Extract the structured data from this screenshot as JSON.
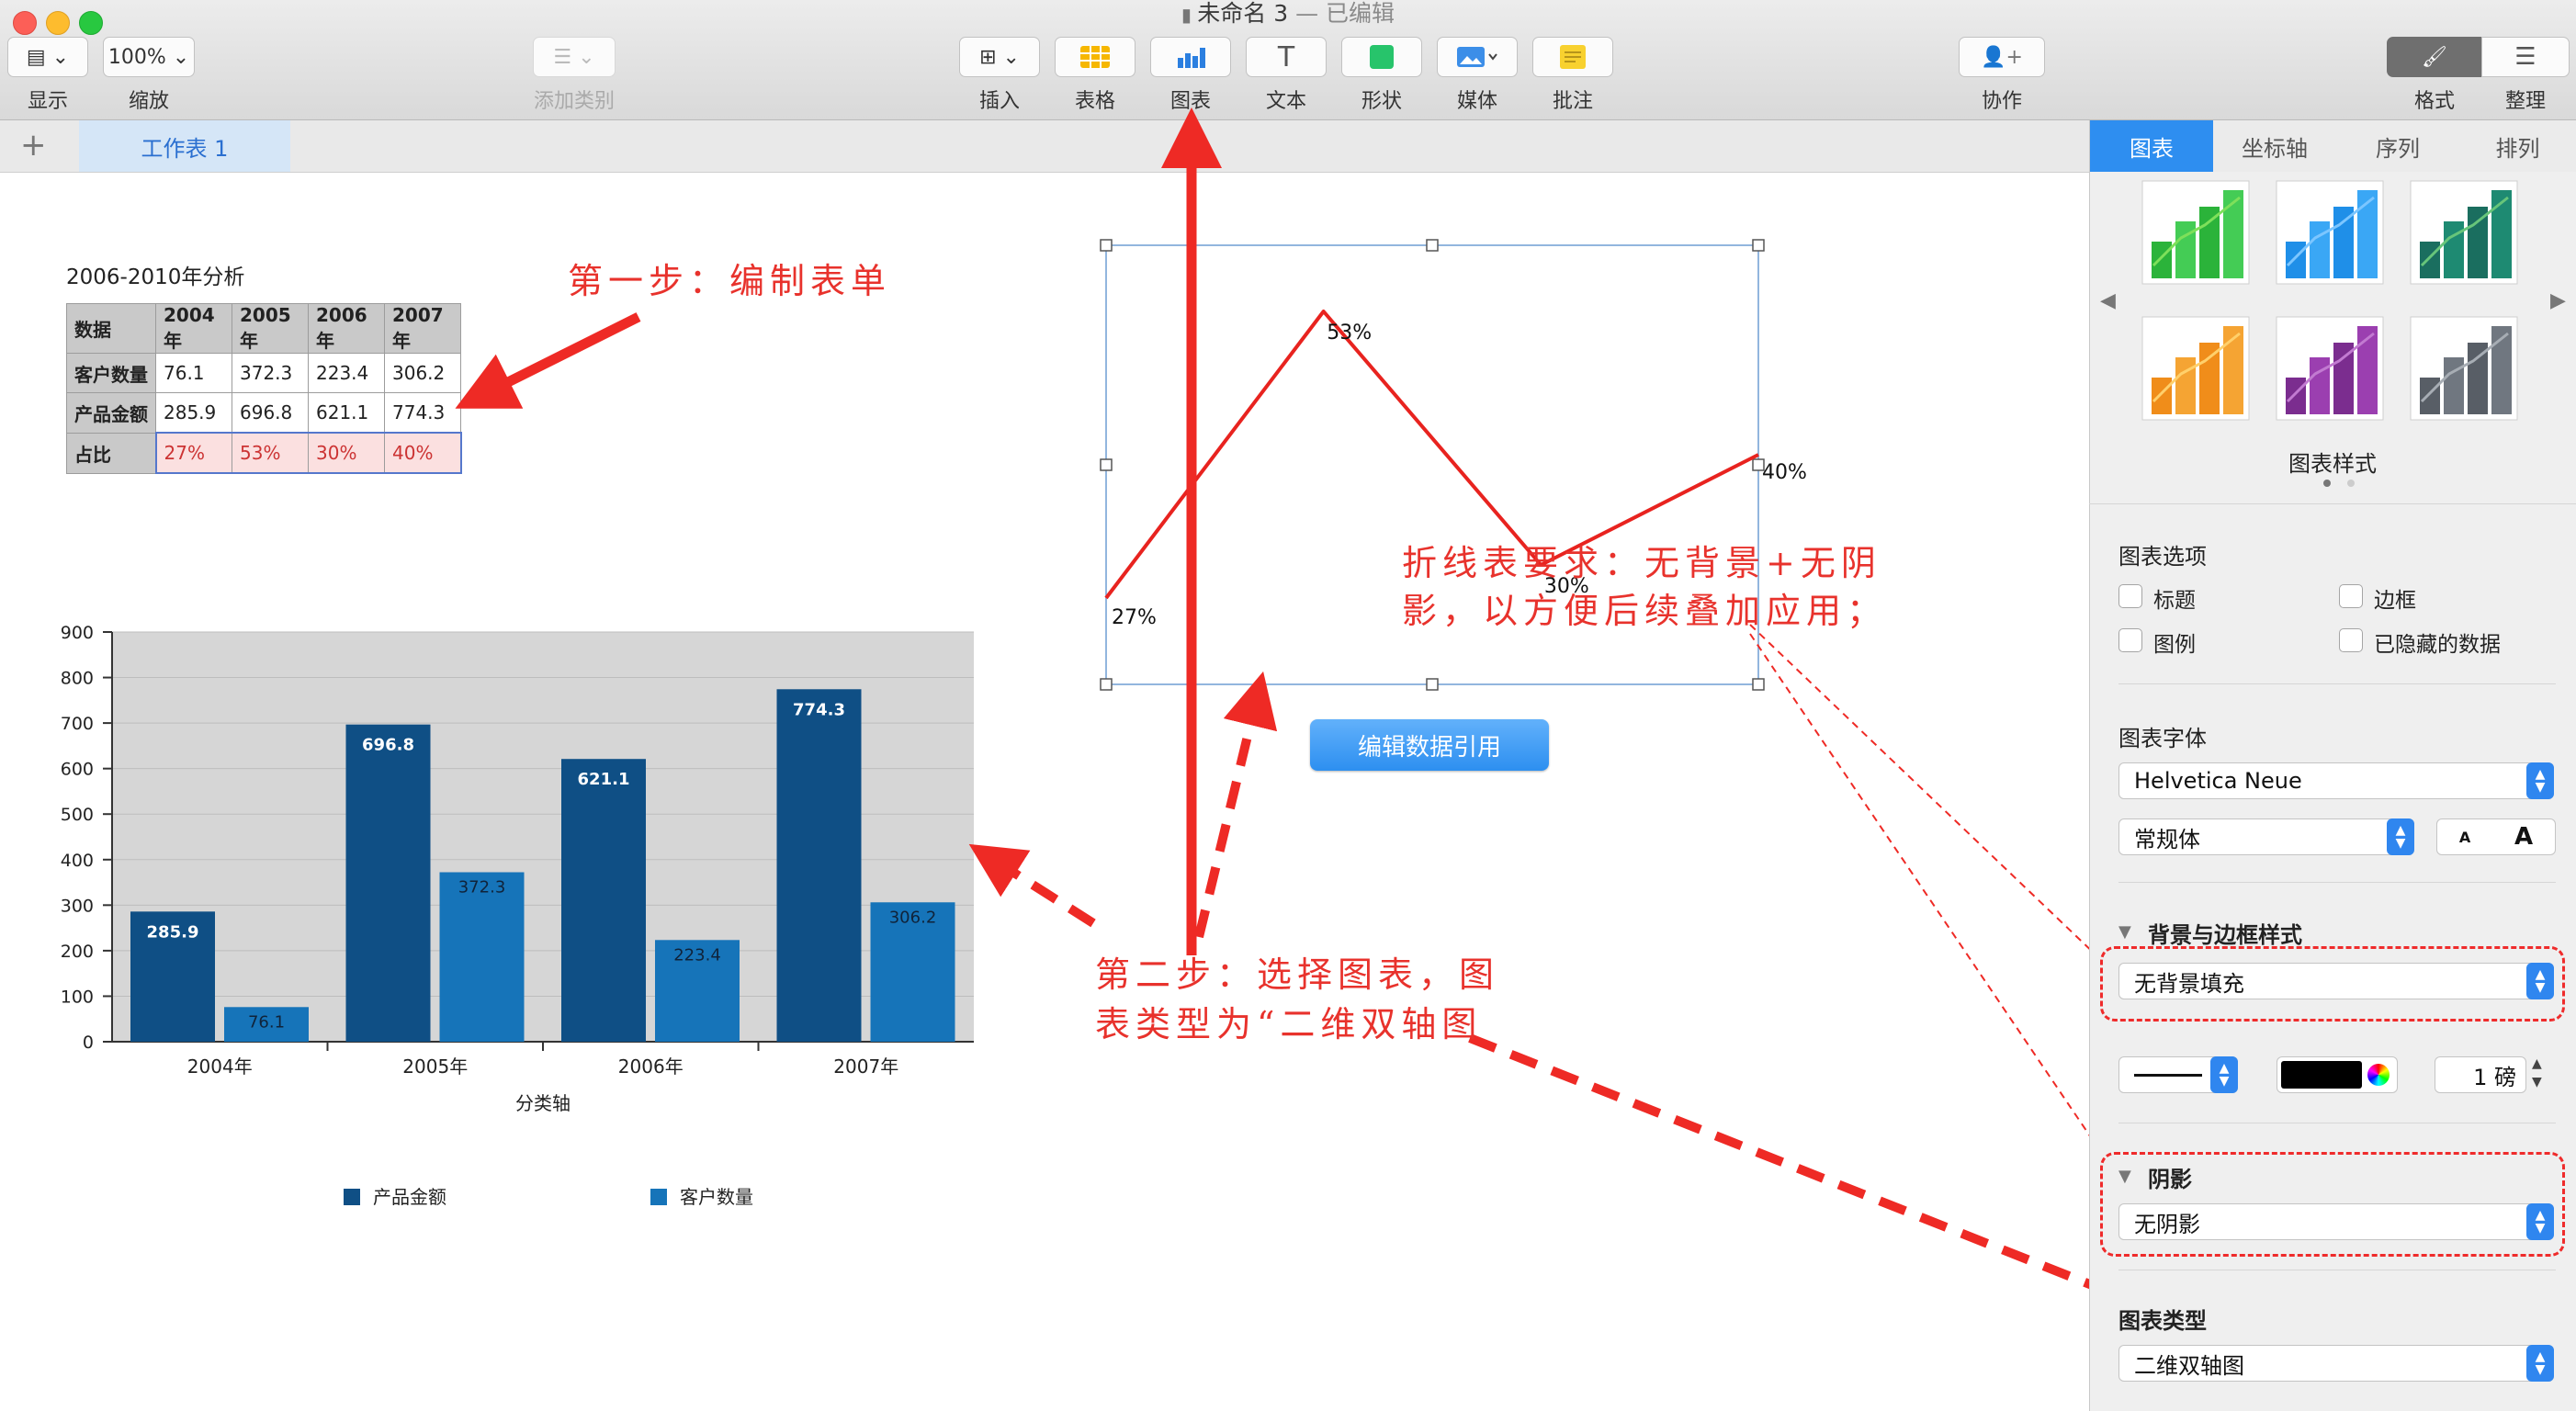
{
  "window": {
    "title": "未命名 3",
    "edited_suffix": " — 已编辑"
  },
  "toolbar": {
    "view": {
      "label": "显示"
    },
    "zoom": {
      "value": "100%",
      "label": "缩放"
    },
    "add_category": {
      "label": "添加类别"
    },
    "insert": {
      "label": "插入"
    },
    "table": {
      "label": "表格"
    },
    "chart": {
      "label": "图表"
    },
    "text": {
      "label": "文本"
    },
    "shape": {
      "label": "形状"
    },
    "media": {
      "label": "媒体"
    },
    "comment": {
      "label": "批注"
    },
    "collaborate": {
      "label": "协作"
    },
    "format": {
      "label": "格式"
    },
    "organize": {
      "label": "整理"
    }
  },
  "sheets": {
    "add": "+",
    "tabs": [
      {
        "label": "工作表 1"
      }
    ]
  },
  "table": {
    "title": "2006-2010年分析",
    "headers": [
      "数据",
      "2004年",
      "2005年",
      "2006年",
      "2007年"
    ],
    "rows": [
      [
        "客户数量",
        "76.1",
        "372.3",
        "223.4",
        "306.2"
      ],
      [
        "产品金额",
        "285.9",
        "696.8",
        "621.1",
        "774.3"
      ],
      [
        "占比",
        "27%",
        "53%",
        "30%",
        "40%"
      ]
    ]
  },
  "bar_chart": {
    "y_ticks": [
      "900",
      "800",
      "700",
      "600",
      "500",
      "400",
      "300",
      "200",
      "100",
      "0"
    ],
    "x_title": "分类轴",
    "colors": {
      "product": "#0f4f85",
      "customer": "#1674b9",
      "plot_bg": "#d6d6d6"
    },
    "legend": [
      "产品金额",
      "客户数量"
    ]
  },
  "chart_data": [
    {
      "type": "bar",
      "categories": [
        "2004年",
        "2005年",
        "2006年",
        "2007年"
      ],
      "series": [
        {
          "name": "产品金额",
          "values": [
            285.9,
            696.8,
            621.1,
            774.3
          ]
        },
        {
          "name": "客户数量",
          "values": [
            76.1,
            372.3,
            223.4,
            306.2
          ]
        }
      ],
      "xlabel": "分类轴",
      "ylabel": "",
      "ylim": [
        0,
        900
      ],
      "grid": true,
      "legend": "bottom"
    },
    {
      "type": "line",
      "categories": [
        "2004年",
        "2005年",
        "2006年",
        "2007年"
      ],
      "series": [
        {
          "values": [
            27,
            53,
            30,
            40
          ]
        }
      ],
      "data_labels": [
        "27%",
        "53%",
        "30%",
        "40%"
      ],
      "line_color": "#e8231f",
      "grid": false
    }
  ],
  "line_chart": {
    "edit_button": "编辑数据引用"
  },
  "annotations": {
    "step1": "第一步：编制表单",
    "step2_line1": "第二步：选择图表，图",
    "step2_line2": "表类型为“二维双轴图",
    "requirement_line1": "折线表要求：无背景+无阴",
    "requirement_line2": "影，以方便后续叠加应用；",
    "color": "#e8322c"
  },
  "sidebar": {
    "tabs": [
      "图表",
      "坐标轴",
      "序列",
      "排列"
    ],
    "chart_styles_label": "图表样式",
    "chart_options": {
      "title": "图表选项",
      "items": [
        {
          "label": "标题",
          "checked": false
        },
        {
          "label": "边框",
          "checked": false
        },
        {
          "label": "图例",
          "checked": false
        },
        {
          "label": "已隐藏的数据",
          "checked": false
        }
      ]
    },
    "chart_font": {
      "title": "图表字体",
      "family": "Helvetica Neue",
      "style": "常规体",
      "smaller": "A",
      "larger": "A"
    },
    "background": {
      "title": "背景与边框样式",
      "fill": "无背景填充",
      "stroke_width": "1 磅"
    },
    "shadow": {
      "title": "阴影",
      "value": "无阴影"
    },
    "chart_type": {
      "title": "图表类型",
      "value": "二维双轴图"
    }
  }
}
